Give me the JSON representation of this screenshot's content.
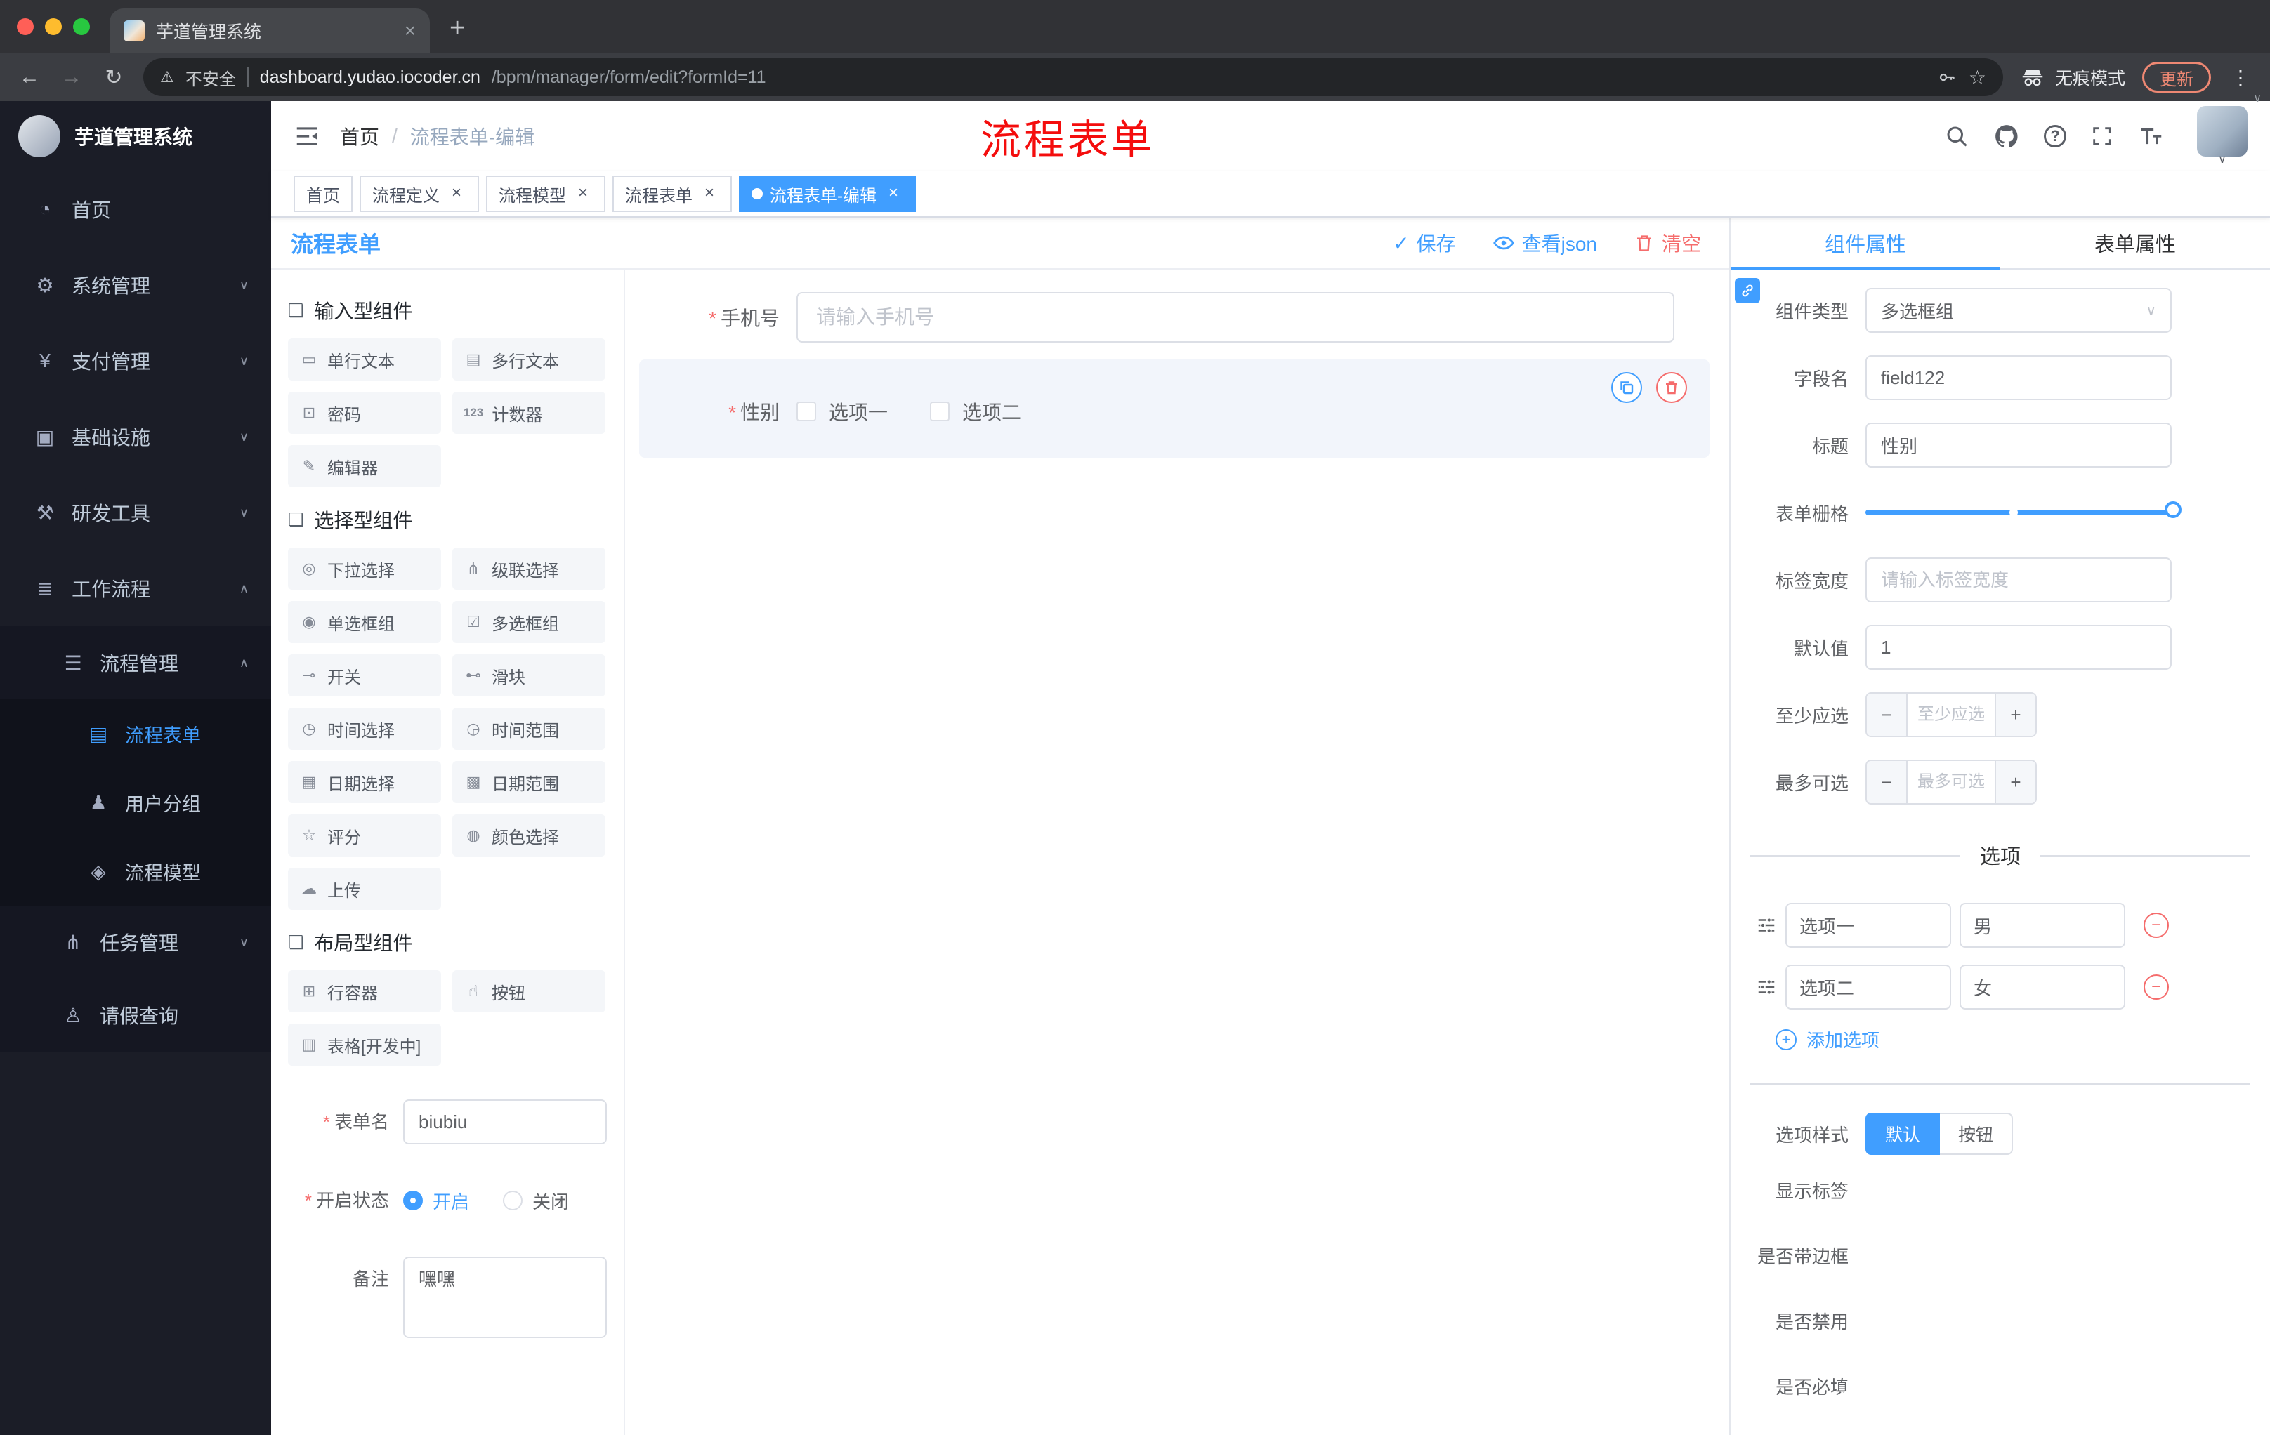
{
  "glyphs": {
    "close": "×",
    "plus": "+",
    "minus": "−",
    "check": "✓",
    "star": "☆",
    "warning": "⚠",
    "back": "←",
    "forward": "→",
    "reload": "↻",
    "kebab": "⋮",
    "chevron_down": "∨",
    "chevron_up": "∧",
    "question": "?",
    "asterisk": "*",
    "slash": "/"
  },
  "browser": {
    "tab": {
      "title": "芋道管理系统"
    },
    "toolbar": {
      "security_label": "不安全",
      "url_domain": "dashboard.yudao.iocoder.cn",
      "url_path": "/bpm/manager/form/edit?formId=11",
      "incognito_label": "无痕模式",
      "update_label": "更新"
    }
  },
  "sidebar": {
    "logo_title": "芋道管理系统",
    "items": [
      {
        "icon": "◔",
        "label": "首页"
      },
      {
        "icon": "⚙",
        "label": "系统管理",
        "arrow": "∨"
      },
      {
        "icon": "¥",
        "label": "支付管理",
        "arrow": "∨"
      },
      {
        "icon": "▣",
        "label": "基础设施",
        "arrow": "∨"
      },
      {
        "icon": "⚒",
        "label": "研发工具",
        "arrow": "∨"
      },
      {
        "icon": "≣",
        "label": "工作流程",
        "arrow": "∧"
      }
    ],
    "submenu": {
      "process_mgmt": {
        "icon": "☰",
        "label": "流程管理",
        "arrow": "∧"
      },
      "children": [
        {
          "icon": "▤",
          "label": "流程表单"
        },
        {
          "icon": "♟",
          "label": "用户分组"
        },
        {
          "icon": "◈",
          "label": "流程模型"
        }
      ],
      "task_mgmt": {
        "icon": "⋔",
        "label": "任务管理",
        "arrow": "∨"
      },
      "leave_query": {
        "icon": "♙",
        "label": "请假查询"
      }
    }
  },
  "header": {
    "breadcrumb": {
      "home": "首页",
      "sep": "/",
      "current": "流程表单-编辑"
    },
    "overlay_title": "流程表单"
  },
  "tags": [
    {
      "label": "首页"
    },
    {
      "label": "流程定义"
    },
    {
      "label": "流程模型"
    },
    {
      "label": "流程表单"
    },
    {
      "label": "流程表单-编辑"
    }
  ],
  "designer": {
    "title": "流程表单",
    "actions": {
      "save": "保存",
      "view_json": "查看json",
      "clear": "清空"
    },
    "palette": {
      "groups": [
        {
          "icon": "❏",
          "title": "输入型组件",
          "items": [
            {
              "icon": "▭",
              "label": "单行文本"
            },
            {
              "icon": "▤",
              "label": "多行文本"
            },
            {
              "icon": "⊡",
              "label": "密码"
            },
            {
              "icon": "123",
              "label": "计数器"
            },
            {
              "icon": "✎",
              "label": "编辑器"
            }
          ]
        },
        {
          "icon": "❏",
          "title": "选择型组件",
          "items": [
            {
              "icon": "◎",
              "label": "下拉选择"
            },
            {
              "icon": "⋔",
              "label": "级联选择"
            },
            {
              "icon": "◉",
              "label": "单选框组"
            },
            {
              "icon": "☑",
              "label": "多选框组"
            },
            {
              "icon": "⊸",
              "label": "开关"
            },
            {
              "icon": "⊷",
              "label": "滑块"
            },
            {
              "icon": "◷",
              "label": "时间选择"
            },
            {
              "icon": "◶",
              "label": "时间范围"
            },
            {
              "icon": "▦",
              "label": "日期选择"
            },
            {
              "icon": "▩",
              "label": "日期范围"
            },
            {
              "icon": "☆",
              "label": "评分"
            },
            {
              "icon": "◍",
              "label": "颜色选择"
            },
            {
              "icon": "☁",
              "label": "上传"
            }
          ]
        },
        {
          "icon": "❏",
          "title": "布局型组件",
          "items": [
            {
              "icon": "⊞",
              "label": "行容器"
            },
            {
              "icon": "☝",
              "label": "按钮"
            },
            {
              "icon": "▥",
              "label": "表格[开发中]"
            }
          ]
        }
      ]
    },
    "meta": {
      "name_label": "表单名",
      "name_value": "biubiu",
      "status_label": "开启状态",
      "status_on": "开启",
      "status_off": "关闭",
      "remark_label": "备注",
      "remark_value": "嘿嘿"
    },
    "preview": {
      "phone": {
        "label": "手机号",
        "placeholder": "请输入手机号"
      },
      "gender": {
        "label": "性别",
        "option1": "选项一",
        "option2": "选项二"
      }
    }
  },
  "props": {
    "tabs": {
      "component": "组件属性",
      "form": "表单属性"
    },
    "rows": {
      "type_label": "组件类型",
      "type_value": "多选框组",
      "field_label": "字段名",
      "field_value": "field122",
      "title_label": "标题",
      "title_value": "性别",
      "grid_label": "表单栅格",
      "label_width_label": "标签宽度",
      "label_width_placeholder": "请输入标签宽度",
      "default_label": "默认值",
      "default_value": "1",
      "min_label": "至少应选",
      "min_placeholder": "至少应选",
      "max_label": "最多可选",
      "max_placeholder": "最多可选",
      "options_divider": "选项",
      "options": [
        {
          "name": "选项一",
          "value": "男"
        },
        {
          "name": "选项二",
          "value": "女"
        }
      ],
      "add_option": "添加选项",
      "style_label": "选项样式",
      "style_default": "默认",
      "style_button": "按钮",
      "show_label": "显示标签",
      "border_label": "是否带边框",
      "disabled_label": "是否禁用",
      "required_label": "是否必填"
    }
  }
}
